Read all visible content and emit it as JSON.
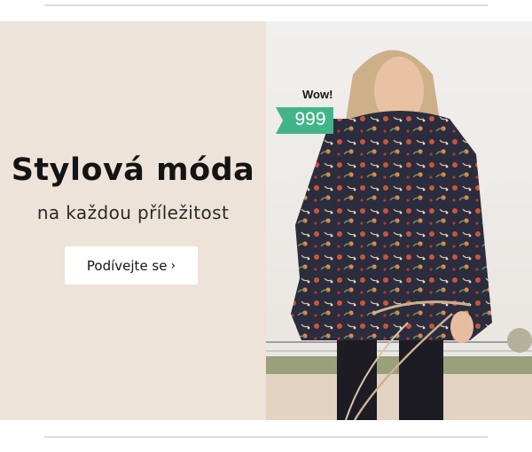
{
  "banner": {
    "headline": "Stylová móda",
    "subline": "na každou příležitost",
    "cta_label": "Podívejte se",
    "cta_arrow": "›",
    "badge": {
      "label": "Wow!",
      "price": "999",
      "color": "#43b48a"
    }
  },
  "colors": {
    "panel_background": "#ede3d9",
    "cta_background": "#ffffff",
    "divider": "#dcdcdc"
  }
}
